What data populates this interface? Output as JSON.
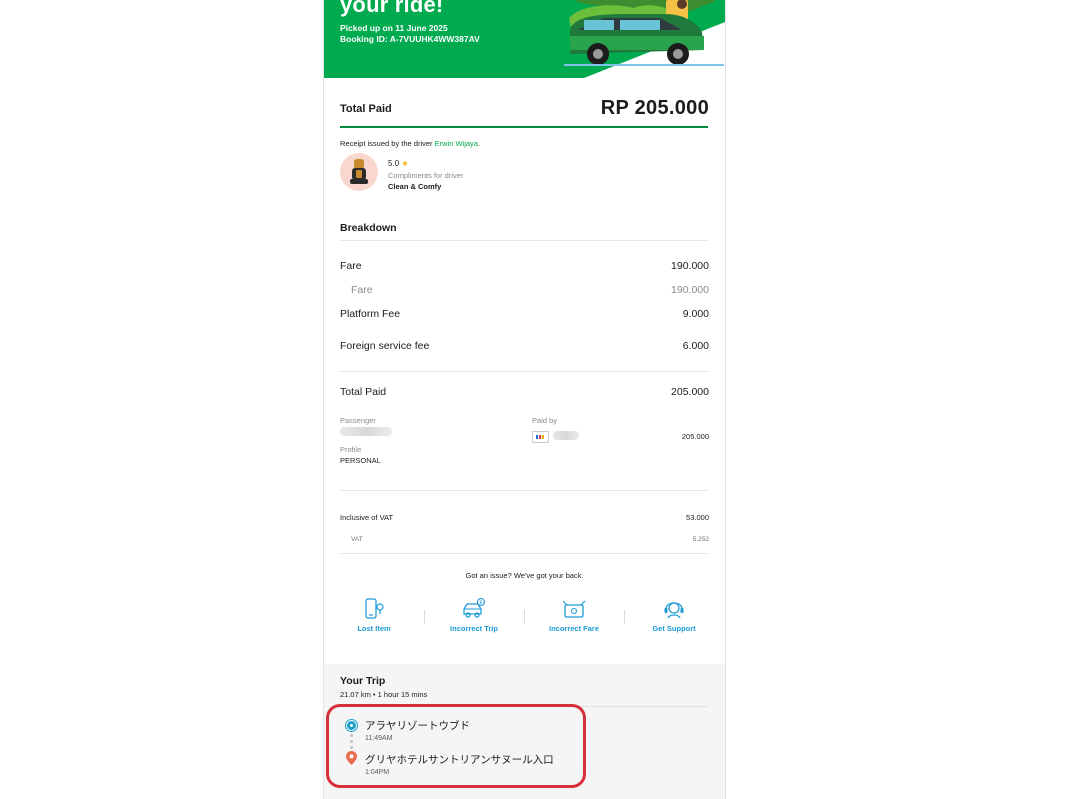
{
  "hero": {
    "title": "your ride!",
    "picked_up": "Picked up on 11 June 2025",
    "booking_id": "Booking ID: A-7VUUHK4WW387AV"
  },
  "summary": {
    "total_paid_label": "Total Paid",
    "total_paid_amount": "RP 205.000"
  },
  "driver": {
    "issued_prefix": "Receipt issued by the driver ",
    "name": "Erwin Wijaya",
    "issued_suffix": ".",
    "rating": "5.0",
    "compliments_label": "Compliments for driver",
    "compliment": "Clean & Comfy"
  },
  "breakdown": {
    "title": "Breakdown",
    "rows": [
      {
        "label": "Fare",
        "value": "190.000"
      },
      {
        "label": "Fare",
        "value": "190.000"
      },
      {
        "label": "Platform Fee",
        "value": "9.000"
      },
      {
        "label": "Foreign service fee",
        "value": "6.000"
      }
    ],
    "total_label": "Total Paid",
    "total_value": "205.000"
  },
  "payment": {
    "passenger_label": "Passenger",
    "paid_by_label": "Paid by",
    "paid_amount": "205.000",
    "profile_label": "Profile",
    "profile_value": "PERSONAL"
  },
  "vat": {
    "inclusive_label": "Inclusive of VAT",
    "inclusive_value": "53.000",
    "vat_label": "VAT",
    "vat_value": "5.252"
  },
  "support": {
    "prompt": "Got an issue? We've got your back.",
    "actions": [
      {
        "label": "Lost Item",
        "icon": "phone-pin-icon"
      },
      {
        "label": "Incorrect Trip",
        "icon": "car-dollar-icon"
      },
      {
        "label": "Incorrect Fare",
        "icon": "fare-card-icon"
      },
      {
        "label": "Get Support",
        "icon": "headset-icon"
      }
    ]
  },
  "trip": {
    "title": "Your Trip",
    "meta": "21.07 km • 1 hour 15 mins",
    "pickup_place": "アラヤリゾートウブド",
    "pickup_time": "11:49AM",
    "dropoff_place": "グリヤホテルサントリアンサヌール入口",
    "dropoff_time": "1:04PM"
  },
  "colors": {
    "brand_green": "#00aa4f",
    "link_blue": "#1d9bd6",
    "highlight_red": "#d6303a"
  }
}
